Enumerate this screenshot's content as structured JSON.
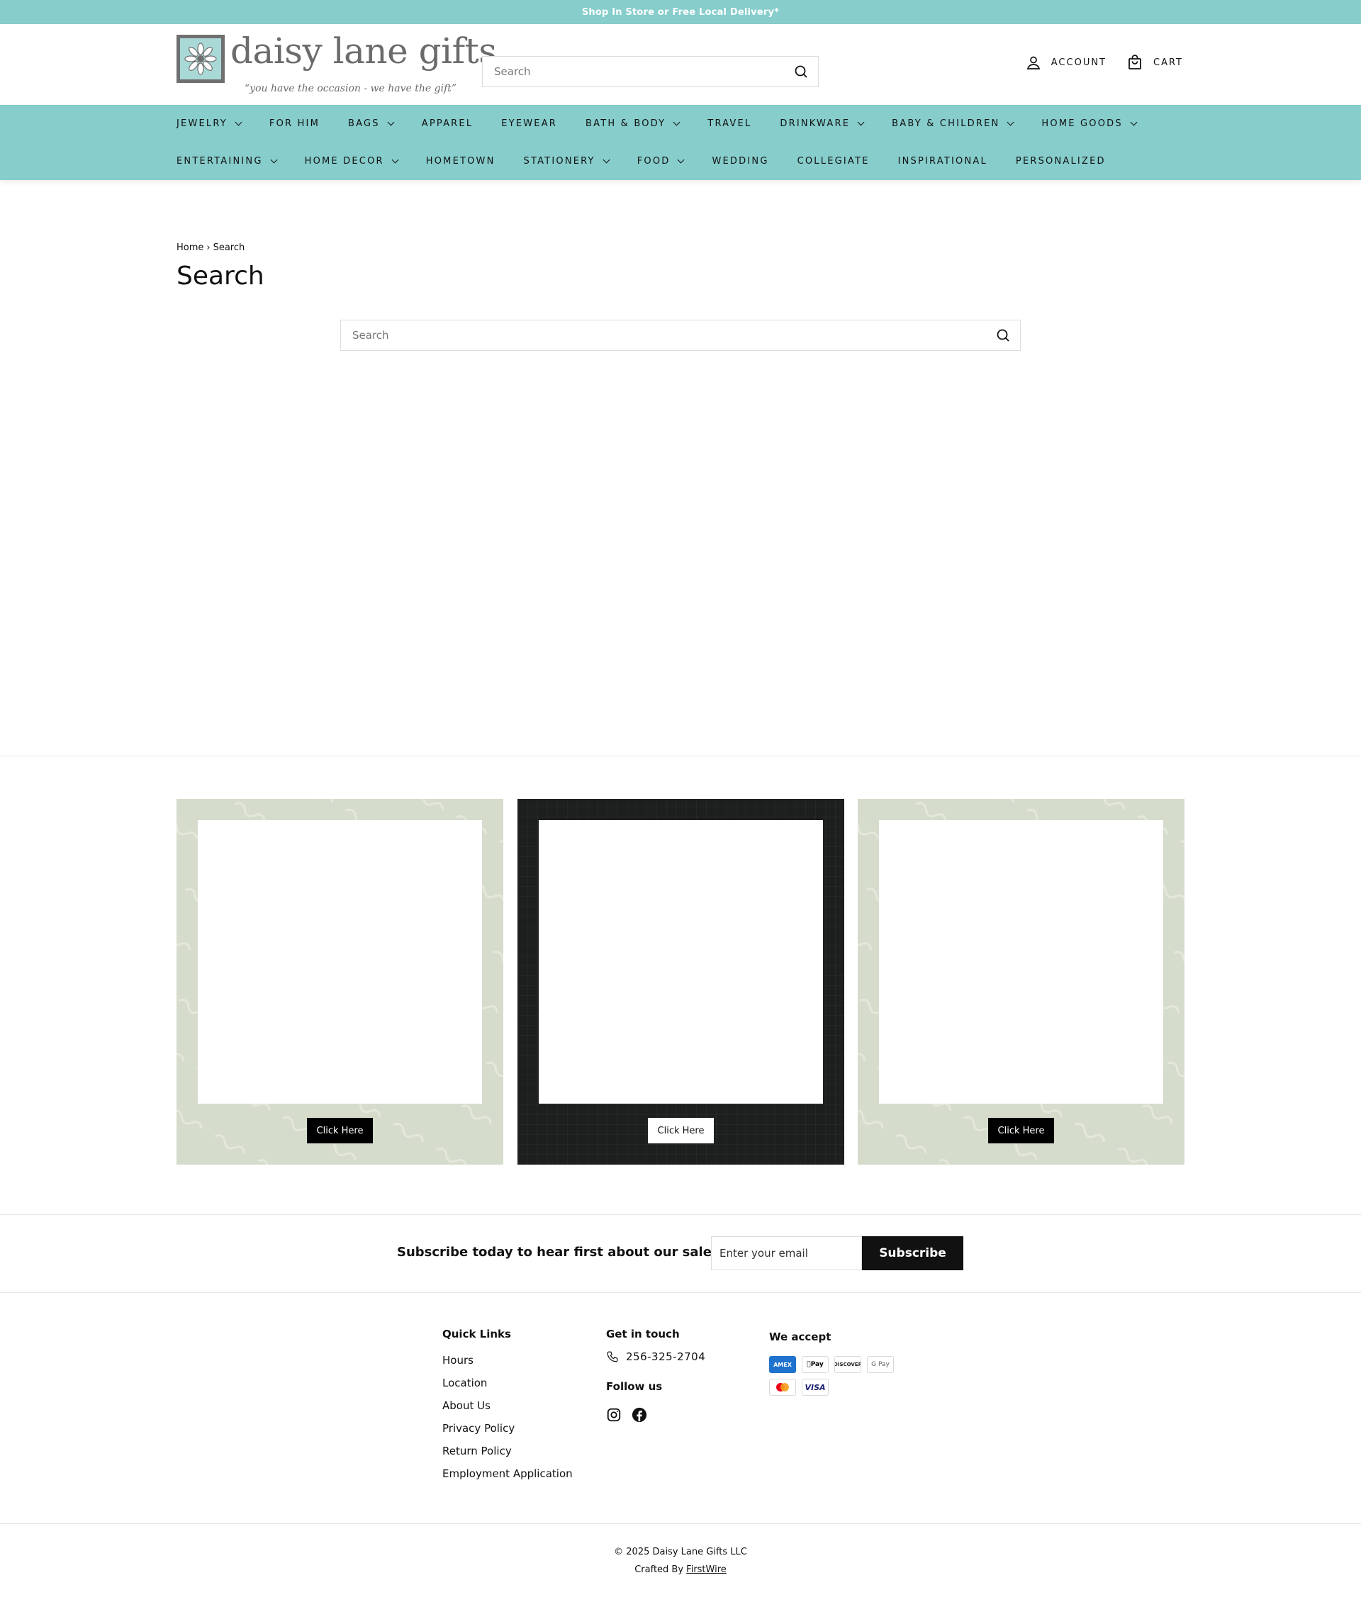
{
  "announcement": "Shop In Store or Free Local Delivery*",
  "header": {
    "logo_name": "daisy lane gifts",
    "logo_tagline": "“you have the occasion - we have the gift”",
    "search_placeholder": "Search",
    "account_label": "ACCOUNT",
    "cart_label": "CART"
  },
  "nav": {
    "row1": [
      {
        "label": "JEWELRY",
        "dropdown": true
      },
      {
        "label": "FOR HIM",
        "dropdown": false
      },
      {
        "label": "BAGS",
        "dropdown": true
      },
      {
        "label": "APPAREL",
        "dropdown": false
      },
      {
        "label": "EYEWEAR",
        "dropdown": false
      },
      {
        "label": "BATH & BODY",
        "dropdown": true
      },
      {
        "label": "TRAVEL",
        "dropdown": false
      },
      {
        "label": "DRINKWARE",
        "dropdown": true
      },
      {
        "label": "BABY & CHILDREN",
        "dropdown": true
      },
      {
        "label": "HOME GOODS",
        "dropdown": true
      }
    ],
    "row2": [
      {
        "label": "ENTERTAINING",
        "dropdown": true
      },
      {
        "label": "HOME DECOR",
        "dropdown": true
      },
      {
        "label": "HOMETOWN",
        "dropdown": false
      },
      {
        "label": "STATIONERY",
        "dropdown": true
      },
      {
        "label": "FOOD",
        "dropdown": true
      },
      {
        "label": "WEDDING",
        "dropdown": false
      },
      {
        "label": "COLLEGIATE",
        "dropdown": false
      },
      {
        "label": "INSPIRATIONAL",
        "dropdown": false
      },
      {
        "label": "PERSONALIZED",
        "dropdown": false
      }
    ]
  },
  "breadcrumb": {
    "home": "Home",
    "separator": "›",
    "current": "Search"
  },
  "page_title": "Search",
  "main_search_placeholder": "Search",
  "promos": [
    {
      "theme": "light",
      "button": "Click Here"
    },
    {
      "theme": "dark",
      "button": "Click Here"
    },
    {
      "theme": "light",
      "button": "Click Here"
    }
  ],
  "subscribe": {
    "label": "Subscribe today to hear first about our sales",
    "placeholder": "Enter your email",
    "button": "Subscribe"
  },
  "footer": {
    "quick_links_heading": "Quick Links",
    "quick_links": [
      "Hours",
      "Location",
      "About Us",
      "Privacy Policy",
      "Return Policy",
      "Employment Application"
    ],
    "contact_heading": "Get in touch",
    "phone": "256-325-2704",
    "follow_heading": "Follow us",
    "social_icons": [
      "instagram-icon",
      "facebook-icon"
    ],
    "accept_heading": "We accept",
    "payments": [
      "AMEX",
      "Pay",
      "DISCOVER",
      "G Pay",
      "",
      "VISA"
    ]
  },
  "copyright": "© 2025 Daisy Lane Gifts LLC",
  "crafted_by_prefix": "Crafted By",
  "crafted_by_link": "FirstWire",
  "colors": {
    "accent": "#86cdcc",
    "promo_light": "#d6dccc",
    "promo_dark": "#1d1e1e",
    "button_dark": "#111111"
  }
}
